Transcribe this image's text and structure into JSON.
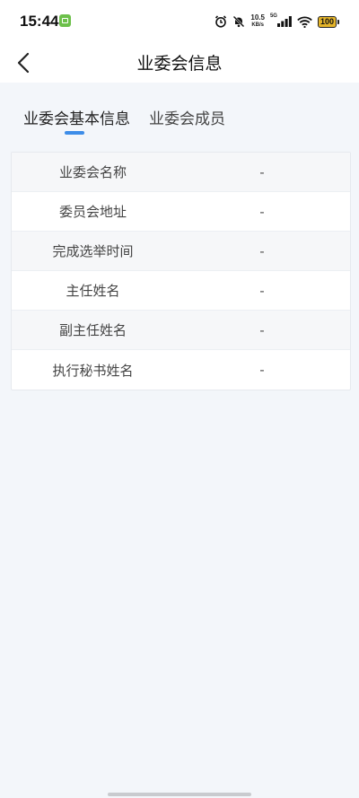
{
  "status_bar": {
    "time": "15:44",
    "net_speed": "10.5",
    "net_unit": "KB/s",
    "network_type": "5G",
    "battery": "100"
  },
  "header": {
    "title": "业委会信息",
    "back_icon": "chevron-left-icon"
  },
  "tabs": [
    {
      "label": "业委会基本信息",
      "active": true
    },
    {
      "label": "业委会成员",
      "active": false
    }
  ],
  "info_rows": [
    {
      "label": "业委会名称",
      "value": "-"
    },
    {
      "label": "委员会地址",
      "value": "-"
    },
    {
      "label": "完成选举时间",
      "value": "-"
    },
    {
      "label": "主任姓名",
      "value": "-"
    },
    {
      "label": "副主任姓名",
      "value": "-"
    },
    {
      "label": "执行秘书姓名",
      "value": "-"
    }
  ],
  "colors": {
    "accent": "#3d8de8",
    "page_background": "#f3f6fa",
    "battery": "#e5b52a"
  }
}
